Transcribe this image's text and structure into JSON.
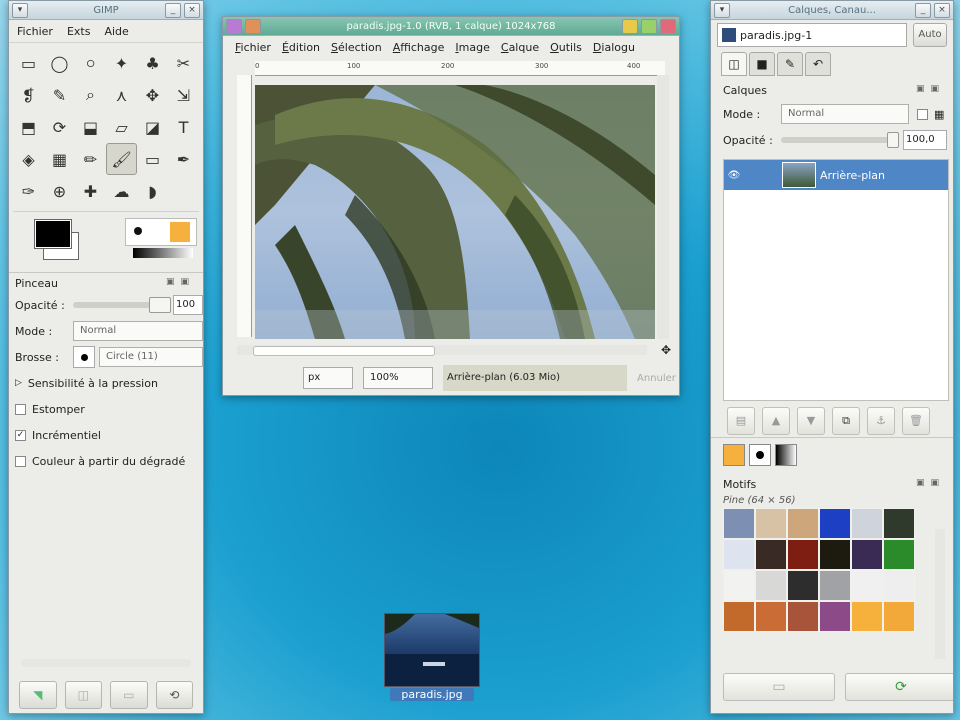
{
  "toolbox": {
    "title": "GIMP",
    "menu": [
      "Fichier",
      "Exts",
      "Aide"
    ],
    "tool_icons": [
      "rect-select-icon",
      "ellipse-select-icon",
      "lasso-icon",
      "fuzzy-select-icon",
      "color-select-icon",
      "scissors-icon",
      "paths-icon",
      "color-picker-icon",
      "zoom-icon",
      "measure-icon",
      "move-icon",
      "align-icon",
      "crop-icon",
      "rotate-icon",
      "scale-icon",
      "shear-icon",
      "perspective-icon",
      "text-icon",
      "bucket-fill-icon",
      "blend-icon",
      "pencil-icon",
      "paintbrush-icon",
      "eraser-icon",
      "airbrush-icon",
      "ink-icon",
      "clone-icon",
      "heal-icon",
      "smudge-icon",
      "dodge-burn-icon"
    ],
    "tool_glyphs": [
      "▭",
      "◯",
      "ဝ",
      "✦",
      "♣",
      "✂",
      "❡",
      "✎",
      "⌕",
      "⋏",
      "✥",
      "⇲",
      "⬒",
      "⟳",
      "⬓",
      "▱",
      "◪",
      "T",
      "◈",
      "▦",
      "✏",
      "🖌",
      "▭",
      "✒",
      "✑",
      "⊕",
      "✚",
      "☁",
      "◗"
    ],
    "selected_tool": 21,
    "options": {
      "title": "Pinceau",
      "opacity_label": "Opacité :",
      "opacity_value": "100",
      "mode_label": "Mode :",
      "mode_value": "Normal",
      "brush_label": "Brosse :",
      "brush_value": "Circle (11)",
      "pressure": "Sensibilité à la pression",
      "checks": [
        {
          "label": "Estomper",
          "checked": false
        },
        {
          "label": "Incrémentiel",
          "checked": true
        },
        {
          "label": "Couleur à partir du dégradé",
          "checked": false
        }
      ]
    }
  },
  "image_window": {
    "title": "paradis.jpg-1.0 (RVB, 1 calque) 1024x768",
    "menu": [
      "Fichier",
      "Édition",
      "Sélection",
      "Affichage",
      "Image",
      "Calque",
      "Outils",
      "Dialogu"
    ],
    "ruler_ticks": [
      "0",
      "100",
      "200",
      "300",
      "400"
    ],
    "unit": "px",
    "zoom": "100%",
    "status": "Arrière-plan (6.03 Mio)",
    "cancel": "Annuler"
  },
  "desktop_icon": {
    "label": "paradis.jpg"
  },
  "dock": {
    "title": "Calques, Canau...",
    "image_combo": "paradis.jpg-1",
    "auto_button": "Auto",
    "layers_title": "Calques",
    "mode_label": "Mode :",
    "mode_value": "Normal",
    "opacity_label": "Opacité :",
    "opacity_value": "100,0",
    "layer_name": "Arrière-plan",
    "patterns_title": "Motifs",
    "pattern_selected": "Pine (64 × 56)",
    "pattern_colors": [
      "#7d8fb2",
      "#d8c2a6",
      "#cda67c",
      "#1d3fc4",
      "#cfd3dc",
      "#2f3a2c",
      "#dde4f0",
      "#3a2a25",
      "#7e1e12",
      "#1d1a10",
      "#3a2b55",
      "#2b8a2a",
      "#f2f2f0",
      "#d8d8d6",
      "#2d2d2e",
      "#a1a2a6",
      "#f0f0f0",
      "#eeeeee",
      "#c26a2c",
      "#c96c35",
      "#a8543a",
      "#8c4a88",
      "#f6b13c",
      "#f2a93a"
    ]
  }
}
